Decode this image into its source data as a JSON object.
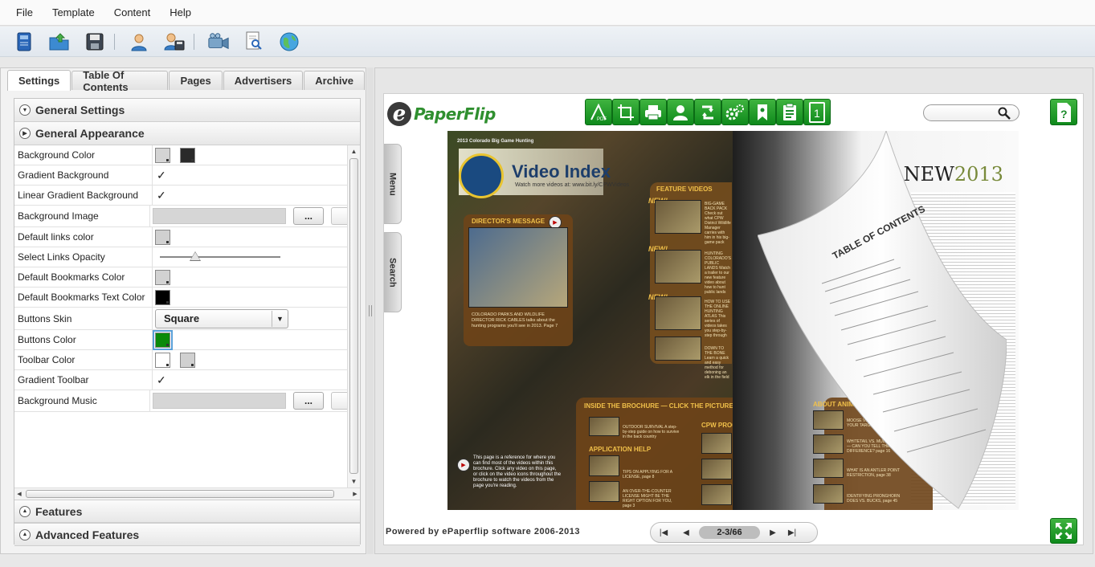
{
  "menu": {
    "items": [
      "File",
      "Template",
      "Content",
      "Help"
    ]
  },
  "toolbar": {
    "icons": [
      "new-book-icon",
      "open-folder-icon",
      "save-disk-icon",
      "user-icon",
      "publish-user-icon",
      "video-camera-icon",
      "preview-document-icon",
      "globe-icon"
    ]
  },
  "left_panel": {
    "tabs": [
      "Settings",
      "Table Of Contents",
      "Pages",
      "Advertisers",
      "Archive"
    ],
    "active_tab": "Settings",
    "sections": {
      "general_settings": "General Settings",
      "general_appearance": "General Appearance",
      "features": "Features",
      "advanced_features": "Advanced Features"
    },
    "properties": [
      {
        "label": "Background Color"
      },
      {
        "label": "Gradient Background",
        "checked": true
      },
      {
        "label": "Linear Gradient Background",
        "checked": true
      },
      {
        "label": "Background Image",
        "button": "..."
      },
      {
        "label": "Default links color"
      },
      {
        "label": "Select Links Opacity"
      },
      {
        "label": "Default Bookmarks Color"
      },
      {
        "label": "Default Bookmarks Text Color"
      },
      {
        "label": "Buttons Skin",
        "value": "Square"
      },
      {
        "label": "Buttons Color"
      },
      {
        "label": "Toolbar Color"
      },
      {
        "label": "Gradient Toolbar",
        "checked": true
      },
      {
        "label": "Background Music",
        "button": "..."
      }
    ],
    "check_mark": "✓",
    "colors": {
      "bg_color_1": "#d4d4d4",
      "bg_color_2": "#2a2a2a",
      "links_color": "#d0d0d0",
      "bookmarks_color": "#d2d2d2",
      "bookmarks_text_color": "#000000",
      "buttons_color": "#0a8a0a",
      "toolbar_color_1": "#ffffff",
      "toolbar_color_2": "#d0d0d0"
    }
  },
  "viewer": {
    "logo_letter": "e",
    "logo_text": "PaperFlip",
    "pdf_label": "PDF",
    "page_num_icon_label": "1",
    "side_tabs": {
      "menu": "Menu",
      "search": "Search"
    },
    "powered_by": "Powered by ePaperflip software 2006-2013",
    "page_indicator": "2-3/66",
    "accent_green": "#1a9a28"
  },
  "magazine": {
    "left_top": "2013 Colorado Big Game Hunting",
    "title": "Video Index",
    "subtitle": "Watch more videos at: www.bit.ly/CPWVideos",
    "directors_message": "DIRECTOR'S MESSAGE",
    "directors_caption": "COLORADO PARKS AND WILDLIFE DIRECTOR RICK CABLES talks about the hunting programs you'll see in 2013. Page 7",
    "feature_videos": "FEATURE VIDEOS",
    "new_tag": "NEW!",
    "feature_1": "BIG-GAME BACK PACK Check out what CPW District Wildlife Manager carries with him in his big-game pack",
    "feature_2": "HUNTING COLORADO'S PUBLIC LANDS Watch a trailer to our new feature video about how to hunt public lands",
    "feature_3": "HOW TO USE THE ONLINE HUNTING ATLAS This series of videos takes you step-by-step through",
    "feature_4": "DOWN TO THE BONE Learn a quick and easy method for deboning an elk in the field",
    "inside_title": "INSIDE THE BROCHURE — CLICK THE PICTURE TO PLAY THE VIDEO",
    "outdoor_survival": "OUTDOOR SURVIVAL A step-by-step guide on how to survive in the back country",
    "application_help": "APPLICATION HELP",
    "app_1": "TIPS ON APPLYING FOR A LICENSE, page 8",
    "app_2": "AN OVER-THE-COUNTER LICENSE MIGHT BE THE RIGHT OPTION FOR YOU, page 3",
    "cpw_programs": "CPW PROGRAMS",
    "cpw_1": "COLORADO'S OHV PROGRAM, page 14",
    "cpw_2": "WATCH A CPW OFFICER PERFORM A HEAD TOOTH EXTRACTION, page 52",
    "cpw_3": "OPERATION GAME THIEF — HELP CATCH POACHERS, back cover",
    "about_animals": "ABOUT ANIMALS",
    "animal_1": "MOOSE VS. ELK — KNOW YOUR TARGET page 11",
    "animal_2": "WHITETAIL VS. MULE DEER — CAN YOU TELL THE DIFFERENCE? page 16",
    "animal_3": "WHAT IS AN ANTLER POINT RESTRICTION, page 38",
    "animal_4": "IDENTIFYING PRONGHORN DOES VS. BUCKS, page 45",
    "left_note": "This page is a reference for where you can find most of the videos within this brochure. Click any video on this page, or click on the video icons throughout the brochure to watch the videos from the page you're reading.",
    "right_top": "2013 Colorado Big Game Hunting",
    "right_title_a": "'S NEW",
    "right_title_b": "2013",
    "curl_title": "TABLE OF CONTENTS"
  }
}
